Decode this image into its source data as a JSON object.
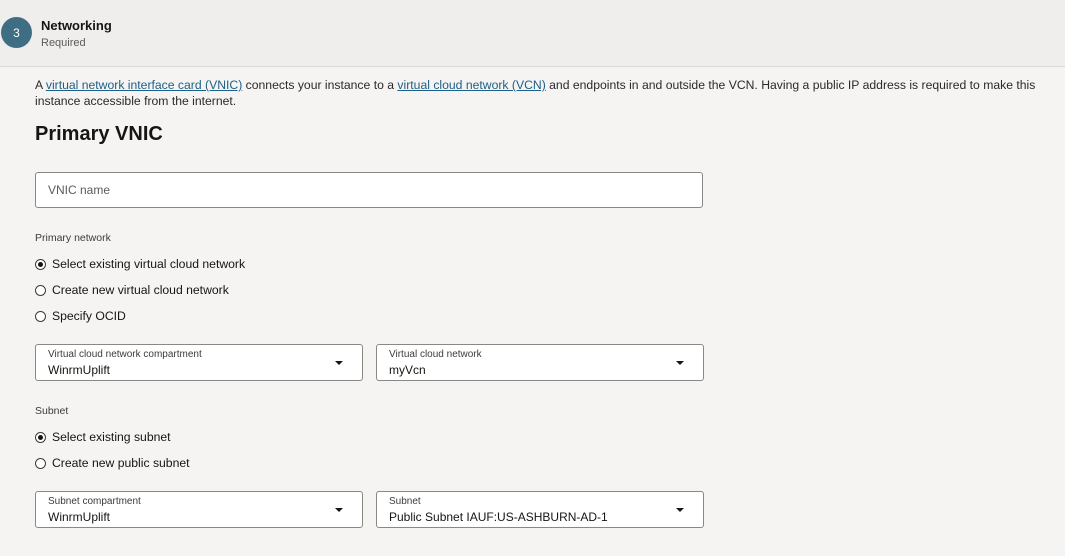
{
  "step": {
    "number": "3",
    "title": "Networking",
    "subtitle": "Required"
  },
  "intro": {
    "part1": "A ",
    "link1": "virtual network interface card (VNIC)",
    "part2": " connects your instance to a ",
    "link2": "virtual cloud network (VCN)",
    "part3": " and endpoints in and outside the VCN. Having a public IP address is required to make this instance accessible from the internet."
  },
  "primary_vnic": {
    "title": "Primary VNIC",
    "vnic_name_placeholder": "VNIC name",
    "vnic_name_value": ""
  },
  "primary_network": {
    "label": "Primary network",
    "options": [
      {
        "label": "Select existing virtual cloud network",
        "selected": true
      },
      {
        "label": "Create new virtual cloud network",
        "selected": false
      },
      {
        "label": "Specify OCID",
        "selected": false
      }
    ],
    "compartment": {
      "label": "Virtual cloud network compartment",
      "value": "WinrmUplift"
    },
    "vcn": {
      "label": "Virtual cloud network",
      "value": "myVcn"
    }
  },
  "subnet": {
    "label": "Subnet",
    "options": [
      {
        "label": "Select existing subnet",
        "selected": true
      },
      {
        "label": "Create new public subnet",
        "selected": false
      }
    ],
    "compartment": {
      "label": "Subnet compartment",
      "value": "WinrmUplift"
    },
    "subnet_select": {
      "label": "Subnet",
      "value": "Public Subnet IAUF:US-ASHBURN-AD-1"
    }
  },
  "colors": {
    "step_circle": "#3f6d83",
    "link": "#1c5f88",
    "background": "#f5f4f2"
  }
}
